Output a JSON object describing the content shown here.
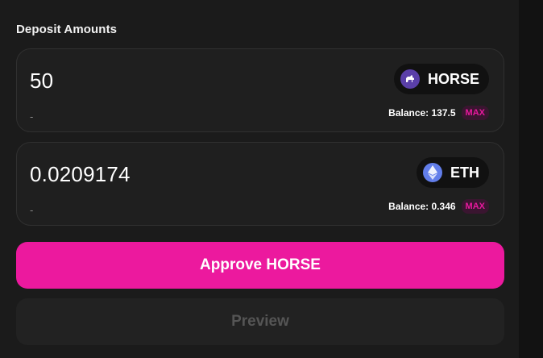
{
  "section_title": "Deposit Amounts",
  "colors": {
    "accent": "#ec199e",
    "background": "#1b1b1b",
    "card": "#1f1f1f",
    "max_text": "#e8199e"
  },
  "deposits": [
    {
      "amount": "50",
      "usd": "-",
      "token": {
        "symbol": "HORSE",
        "icon": "horse-icon"
      },
      "balance": "Balance: 137.5",
      "max_label": "MAX"
    },
    {
      "amount": "0.0209174",
      "usd": "-",
      "token": {
        "symbol": "ETH",
        "icon": "eth-icon"
      },
      "balance": "Balance: 0.346",
      "max_label": "MAX"
    }
  ],
  "approve_label": "Approve HORSE",
  "preview_label": "Preview"
}
